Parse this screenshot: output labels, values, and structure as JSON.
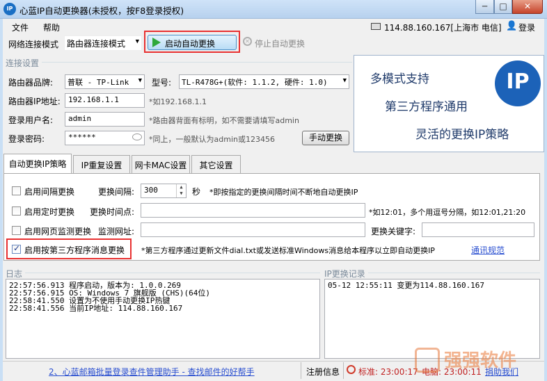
{
  "window": {
    "title": "心蓝IP自动更换器(未授权，按F8登录授权)",
    "icon_text": "IP",
    "min_label": "─",
    "max_label": "□",
    "close_label": "✕"
  },
  "menu": {
    "file": "文件",
    "help": "帮助",
    "ip_info": "114.88.160.167[上海市 电信]",
    "login": "登录"
  },
  "toolbar": {
    "mode_label": "网络连接模式",
    "mode_value": "路由器连接模式",
    "start_label": "启动自动更换",
    "stop_label": "停止自动更换"
  },
  "connection": {
    "group_title": "连接设置",
    "brand_label": "路由器品牌:",
    "brand_value": "普联 - TP-Link",
    "model_label": "型号:",
    "model_value": "TL-R478G+(软件: 1.1.2, 硬件: 1.0)",
    "ip_label": "路由器IP地址:",
    "ip_value": "192.168.1.1",
    "ip_hint": "*如192.168.1.1",
    "user_label": "登录用户名:",
    "user_value": "admin",
    "user_hint": "*路由器背面有标明，如不需要请填写admin",
    "pass_label": "登录密码:",
    "pass_value": "******",
    "pass_hint": "*同上，一般默认为admin或123456",
    "manual_button": "手动更换"
  },
  "ad": {
    "line1": "多模式支持",
    "line2": "第三方程序通用",
    "line3": "灵活的更换IP策略",
    "logo_text": "IP"
  },
  "tabs": [
    "自动更换IP策略",
    "IP重复设置",
    "网卡MAC设置",
    "其它设置"
  ],
  "strategy": {
    "interval_check": "启用间隔更换",
    "interval_label": "更换间隔:",
    "interval_value": "300",
    "interval_unit": "秒",
    "interval_hint": "*即按指定的更换间隔时间不断地自动更换IP",
    "timed_check": "启用定时更换",
    "timed_label": "更换时间点:",
    "timed_value": "",
    "timed_hint": "*如12:01，多个用逗号分隔，如12:01,21:20",
    "web_check": "启用网页监测更换",
    "web_label": "监测网址:",
    "web_value": "",
    "keyword_label": "更换关键字:",
    "keyword_value": "",
    "third_check": "启用按第三方程序消息更换",
    "third_hint": "*第三方程序通过更新文件dial.txt或发送标准Windows消息给本程序以立即自动更换IP",
    "third_link": "通讯规范"
  },
  "log": {
    "title": "日志",
    "lines": [
      "22:57:56.913 程序启动，版本为: 1.0.0.269",
      "22:57:56.915 OS: Windows 7 旗舰版 (CHS)(64位)",
      "22:58:41.550 设置为不使用手动更换IP热键",
      "22:58:41.556 当前IP地址: 114.88.160.167"
    ]
  },
  "iplog": {
    "title": "IP更换记录",
    "lines": [
      "05-12 12:55:11 变更为114.88.160.167"
    ]
  },
  "status": {
    "ad_link": "2、心蓝邮箱批量登录查件管理助手 - 查找邮件的好帮手",
    "register": "注册信息",
    "standard_time": "标准: 23:00:17",
    "local_time": "电脑: 23:00:11",
    "donate": "捐助我们"
  },
  "watermark": {
    "text": "强强软件"
  }
}
